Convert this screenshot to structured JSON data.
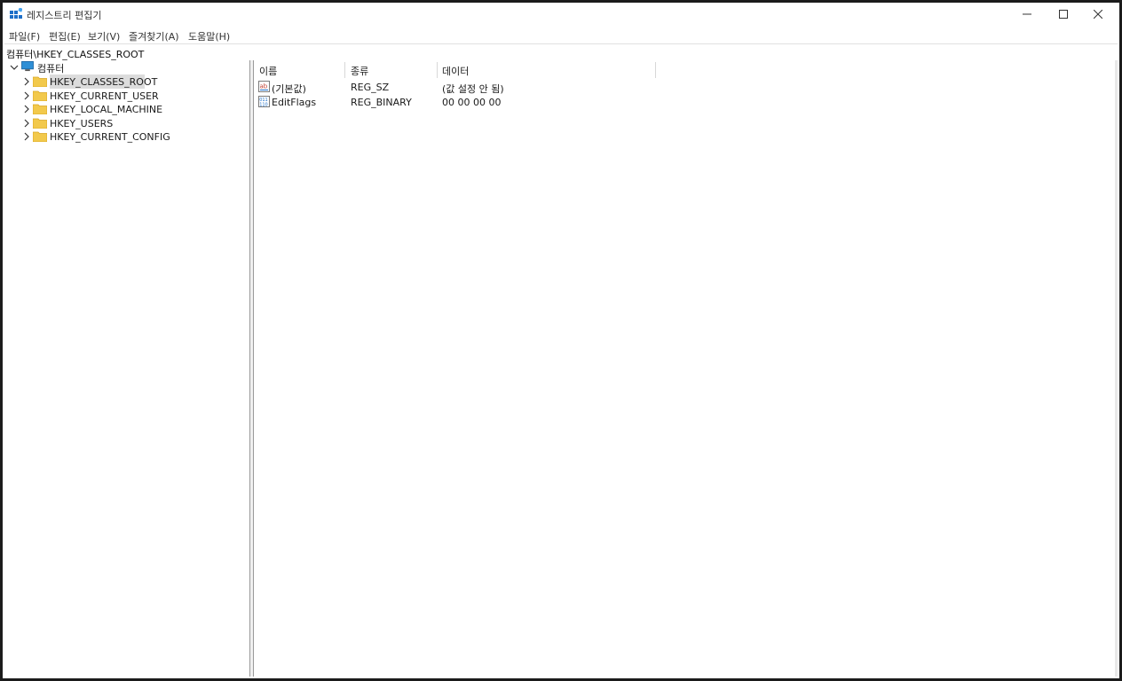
{
  "window": {
    "title": "레지스트리 편집기"
  },
  "menu": [
    "파일(F)",
    "편집(E)",
    "보기(V)",
    "즐겨찾기(A)",
    "도움말(H)"
  ],
  "address": "컴퓨터\\HKEY_CLASSES_ROOT",
  "tree": {
    "root": "컴퓨터",
    "children": [
      "HKEY_CLASSES_ROOT",
      "HKEY_CURRENT_USER",
      "HKEY_LOCAL_MACHINE",
      "HKEY_USERS",
      "HKEY_CURRENT_CONFIG"
    ],
    "selected": "HKEY_CLASSES_ROOT"
  },
  "columns": [
    "이름",
    "종류",
    "데이터"
  ],
  "values": [
    {
      "icon": "string-value-icon",
      "name": "(기본값)",
      "type": "REG_SZ",
      "data": "(값 설정 안 됨)"
    },
    {
      "icon": "binary-value-icon",
      "name": "EditFlags",
      "type": "REG_BINARY",
      "data": "00 00 00 00"
    }
  ],
  "colors": {
    "folder": "#F2C94C",
    "folder_dark": "#D9A520",
    "computer": "#2E8FD6",
    "selection": "#DCDCDC",
    "app_icon": "#1E6FC8"
  }
}
